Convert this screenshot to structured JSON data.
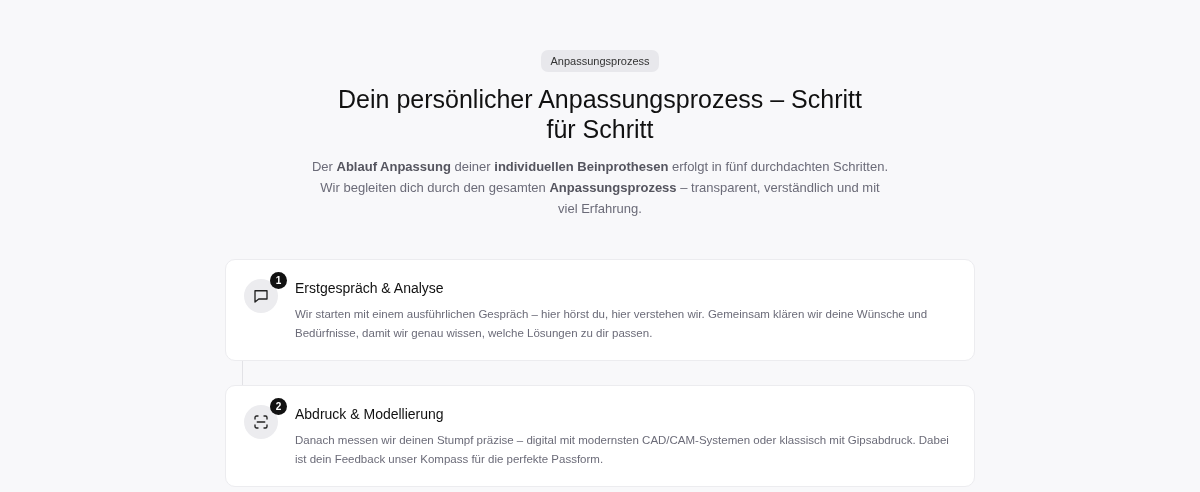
{
  "badge": "Anpassungsprozess",
  "title": "Dein persönlicher Anpassungsprozess – Schritt für Schritt",
  "intro": "Der **Ablauf Anpassung** deiner **individuellen Beinprothesen** erfolgt in fünf durchdachten Schritten. Wir begleiten dich durch den gesamten **Anpassungsprozess** – transparent, verständlich und mit viel Erfahrung.",
  "steps": [
    {
      "number": "1",
      "kind": "chat",
      "title": "Erstgespräch & Analyse",
      "text": "Wir starten mit einem ausführlichen Gespräch – hier hörst du, hier verstehen wir. Gemeinsam klären wir deine Wünsche und Bedürfnisse, damit wir genau wissen, welche Lösungen zu dir passen."
    },
    {
      "number": "2",
      "kind": "scan",
      "title": "Abdruck & Modellierung",
      "text": "Danach messen wir deinen Stumpf präzise – digital mit modernsten CAD/CAM-Systemen oder klassisch mit Gipsabdruck. Dabei ist dein Feedback unser Kompass für die perfekte Passform."
    }
  ]
}
